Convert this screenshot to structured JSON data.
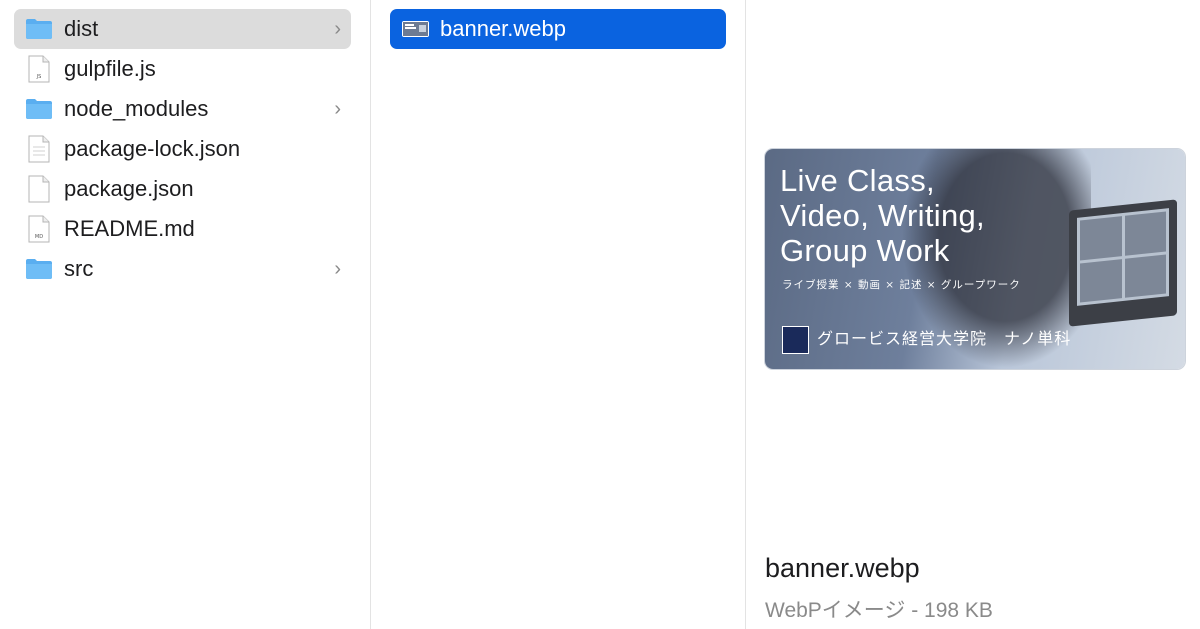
{
  "column1": {
    "items": [
      {
        "name": "dist",
        "type": "folder",
        "has_children": true,
        "selected": true
      },
      {
        "name": "gulpfile.js",
        "type": "file",
        "badge": "JS",
        "has_children": false
      },
      {
        "name": "node_modules",
        "type": "folder",
        "has_children": true
      },
      {
        "name": "package-lock.json",
        "type": "file",
        "has_children": false
      },
      {
        "name": "package.json",
        "type": "file",
        "has_children": false
      },
      {
        "name": "README.md",
        "type": "file",
        "badge": "MD",
        "has_children": false
      },
      {
        "name": "src",
        "type": "folder",
        "has_children": true
      }
    ]
  },
  "column2": {
    "items": [
      {
        "name": "banner.webp",
        "type": "image",
        "selected": true
      }
    ]
  },
  "preview": {
    "banner_headline": "Live Class,\nVideo, Writing,\nGroup Work",
    "banner_subtitle": "ライブ授業 × 動画 × 記述 × グループワーク",
    "banner_logo_text": "グロービス経営大学院　ナノ単科",
    "file_name": "banner.webp",
    "file_meta": "WebPイメージ - 198 KB"
  },
  "colors": {
    "selection_blue": "#0a63e0",
    "folder_blue": "#5aaef0",
    "highlight_gray": "#dcdcdc"
  },
  "icons": {
    "folder": "folder-icon",
    "file": "document-icon",
    "chevron": "chevron-right-icon",
    "image": "image-icon"
  }
}
